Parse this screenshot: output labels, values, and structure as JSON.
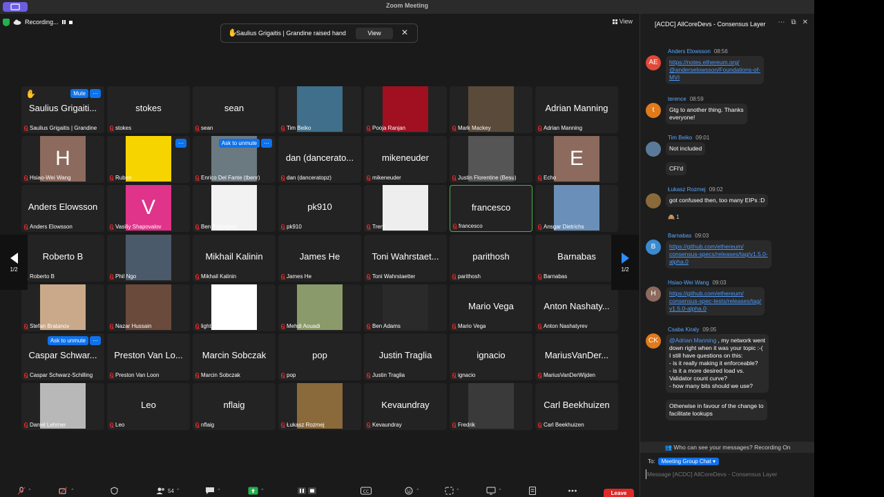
{
  "window": {
    "title": "Zoom Meeting"
  },
  "recording": {
    "label": "Recording..."
  },
  "view_label": "View",
  "raise_banner": {
    "text": "Saulius Grigaitis | Grandine raised hand",
    "view_label": "View",
    "close": "✕"
  },
  "page_indicator": "1/2",
  "tiles": [
    [
      {
        "big": "Saulius Grigaiti...",
        "label": "Saulius Grigaitis | Grandine",
        "hand": "✋",
        "badge": "Mute"
      },
      {
        "big": "stokes",
        "label": "stokes"
      },
      {
        "big": "sean",
        "label": "sean"
      },
      {
        "photo": "#3f6f8a",
        "label": "Tim Beiko"
      },
      {
        "photo": "#a01020",
        "label": "Pooja Ranjan"
      },
      {
        "photo": "#5a4a3a",
        "label": "Mark Mackey"
      },
      {
        "big": "Adrian Manning",
        "label": "Adrian Manning"
      }
    ],
    [
      {
        "letter": "H",
        "letterbg": "#8c6a5d",
        "label": "Hsiao-Wei Wang"
      },
      {
        "photo": "#f5d400",
        "label": "Ruben",
        "dots": true
      },
      {
        "photo": "#6b7a80",
        "label": "Enrico Del Fante (tbenr)",
        "badge": "Ask to unmute"
      },
      {
        "big": "dan (dancerato...",
        "label": "dan (danceratopz)"
      },
      {
        "big": "mikeneuder",
        "label": "mikeneuder"
      },
      {
        "photo": "#555",
        "label": "Justin Florentine (Besu)"
      },
      {
        "letter": "E",
        "letterbg": "#8c6a5d",
        "label": "Echo"
      }
    ],
    [
      {
        "big": "Anders Elowsson",
        "label": "Anders Elowsson"
      },
      {
        "letter": "V",
        "letterbg": "#e0338a",
        "label": "Vasiliy Shapovalov"
      },
      {
        "photo": "#f2f2f2",
        "label": "Ben Edgington"
      },
      {
        "big": "pk910",
        "label": "pk910"
      },
      {
        "photo": "#eeeeee",
        "label": "Trent"
      },
      {
        "big": "francesco",
        "label": "francesco",
        "active": true
      },
      {
        "photo": "#6a8fb8",
        "label": "Ansgar Dietrichs"
      }
    ],
    [
      {
        "big": "Roberto B",
        "label": "Roberto B"
      },
      {
        "photo": "#4a5a6a",
        "label": "Phil Ngo"
      },
      {
        "big": "Mikhail Kalinin",
        "label": "Mikhail Kalinin"
      },
      {
        "big": "James He",
        "label": "James He"
      },
      {
        "big": "Toni Wahrstaet...",
        "label": "Toni Wahrstaetter"
      },
      {
        "big": "parithosh",
        "label": "parithosh"
      },
      {
        "big": "Barnabas",
        "label": "Barnabas"
      }
    ],
    [
      {
        "photo": "#c9a98a",
        "label": "Stefan Bratanov"
      },
      {
        "photo": "#6a4a3a",
        "label": "Nazar Hussain"
      },
      {
        "photo": "#ffffff",
        "label": "lightclient"
      },
      {
        "photo": "#8a9a6a",
        "label": "Mehdi Aouadi"
      },
      {
        "photo": "#2a2a2a",
        "label": "Ben Adams"
      },
      {
        "big": "Mario Vega",
        "label": "Mario Vega"
      },
      {
        "big": "Anton Nashaty...",
        "label": "Anton Nashatyrev"
      }
    ],
    [
      {
        "big": "Caspar Schwar...",
        "label": "Caspar Schwarz-Schilling",
        "badge": "Ask to unmute"
      },
      {
        "big": "Preston Van Lo...",
        "label": "Preston Van Loon"
      },
      {
        "big": "Marcin Sobczak",
        "label": "Marcin Sobczak"
      },
      {
        "big": "pop",
        "label": "pop"
      },
      {
        "big": "Justin Traglia",
        "label": "Justin Traglia"
      },
      {
        "big": "ignacio",
        "label": "ignacio"
      },
      {
        "big": "MariusVanDer...",
        "label": "MariusVanDerWijden"
      }
    ],
    [
      {
        "photo": "#b8b8b8",
        "label": "Daniel Lehrner"
      },
      {
        "big": "Leo",
        "label": "Leo"
      },
      {
        "big": "nflaig",
        "label": "nflaig"
      },
      {
        "photo": "#8a6a3a",
        "label": "Łukasz Rozmej"
      },
      {
        "big": "Kevaundray",
        "label": "Kevaundray"
      },
      {
        "photo": "#3a3a3a",
        "label": "Fredrik"
      },
      {
        "big": "Carl Beekhuizen",
        "label": "Carl Beekhuizen"
      }
    ]
  ],
  "toolbar": {
    "participants_count": "54",
    "leave_label": "Leave"
  },
  "chat": {
    "title": "[ACDC] AllCoreDevs - Consensus Layer",
    "messages": [
      {
        "initials": "AE",
        "color": "#e0493a",
        "sender": "Anders Elowsson",
        "time": "08:56",
        "lines": "https://notes.ethereum.org/\n@anderselowsson/Foundations-of-\nMVI",
        "link": true
      },
      {
        "initials": "t",
        "color": "#e07a1a",
        "sender": "terence",
        "time": "08:59",
        "lines": "Gtg to another thing. Thanks\neveryone!"
      },
      {
        "initials": "",
        "color": "#5a7a9a",
        "sender": "Tim Beiko",
        "time": "09:01",
        "lines": "Not included",
        "extra": "CFI'd"
      },
      {
        "initials": "",
        "color": "#8a6a3a",
        "sender": "Łukasz Rozmej",
        "time": "09:02",
        "lines": "got confused then, too many EIPs :D",
        "reaction": "🙈 1"
      },
      {
        "initials": "B",
        "color": "#3a8ad0",
        "sender": "Barnabas",
        "time": "09:03",
        "lines": "https://github.com/ethereum/\nconsensus-specs/releases/tag/v1.5.0-\nalpha.0",
        "link": true
      },
      {
        "initials": "H",
        "color": "#8c6a5d",
        "sender": "Hsiao-Wei Wang",
        "time": "09:03",
        "lines": "https://github.com/ethereum/\nconsensus-spec-tests/releases/tag/\nv1.5.0-alpha.0",
        "link": true
      },
      {
        "initials": "CK",
        "color": "#e07a1a",
        "sender": "Csaba Kiraly",
        "time": "09:05",
        "mention": "@Adrian Manning",
        "lines": " , my network went\ndown right when it was your topic :-(\nI still have questions on this:\n- is it really making it enforceable?\n- is it a more desired load vs.\nValidator count curve?\n- how many bits should we use?",
        "extra": "Otherwise in favour of the change to\nfacilitate lookups"
      }
    ],
    "privacy_note": "Who can see your messages? Recording On",
    "to_label": "To:",
    "recipient": "Meeting Group Chat",
    "composer_placeholder": "Message [ACDC] AllCoreDevs - Consensus Layer"
  }
}
